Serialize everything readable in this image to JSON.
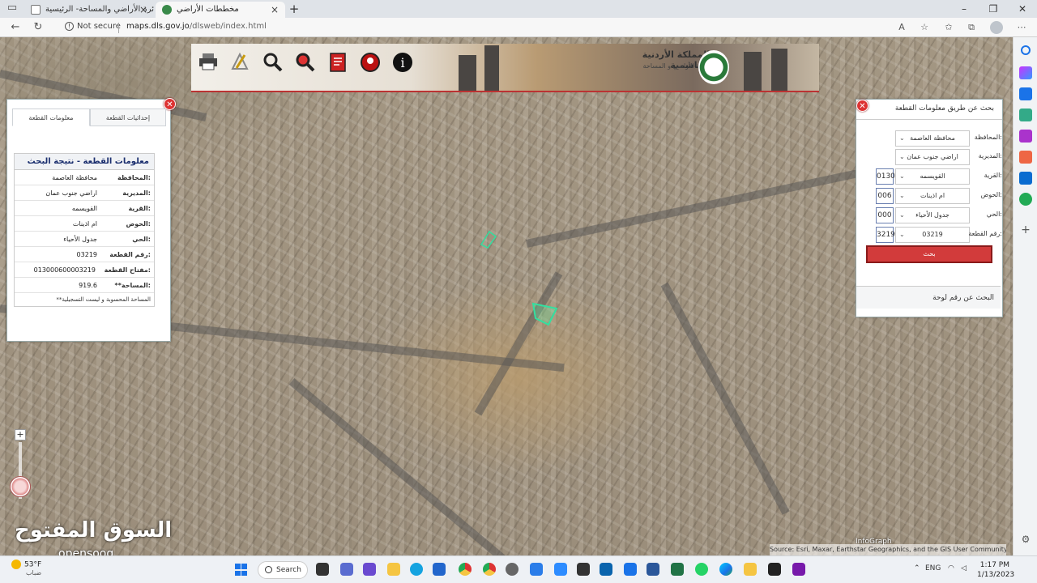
{
  "browser": {
    "tabs": [
      {
        "label": "دائرة الأراضي والمساحة- الرئيسية-",
        "active": false
      },
      {
        "label": "مخططات الأراضي",
        "active": true
      }
    ],
    "security_label": "Not secure",
    "url_host": "maps.dls.gov.jo",
    "url_path": "/dlsweb/index.html"
  },
  "banner": {
    "title": "المملكة الأردنية الهاشمية",
    "subtitle": "دائرة الأراضي و المساحة",
    "tools": [
      "print-icon",
      "measure-icon",
      "zoom-search-icon",
      "parcel-search-icon",
      "report-icon",
      "location-pin-icon",
      "info-icon"
    ]
  },
  "left_panel": {
    "tabs": [
      {
        "label": "إحداثيات القطعة"
      },
      {
        "label": "معلومات القطعة"
      }
    ],
    "result_title": "معلومات القطعة - نتيجة البحث",
    "rows": [
      {
        "label": "المحافظة:",
        "value": "محافظة العاصمة"
      },
      {
        "label": "المديرية:",
        "value": "اراضي جنوب عمان"
      },
      {
        "label": "القرية:",
        "value": "القويسمه"
      },
      {
        "label": "الحوض:",
        "value": "ام اذينات"
      },
      {
        "label": "الحي:",
        "value": "جدول الأحياء"
      },
      {
        "label": "رقم القطعة:",
        "value": "03219"
      },
      {
        "label": "مفتاح القطعة:",
        "value": "013000600003219"
      },
      {
        "label": "**المساحة:",
        "value": "919.6"
      }
    ],
    "note": "**المساحة المحسوبة و ليست التسجيلية"
  },
  "right_panel": {
    "title": "بحث عن طريق معلومات القطعة",
    "fields": [
      {
        "label": "المحافظة:",
        "selected": "محافظة العاصمة",
        "code": ""
      },
      {
        "label": "المديرية:",
        "selected": "اراضي جنوب عمان",
        "code": ""
      },
      {
        "label": "القرية:",
        "selected": "القويسمه",
        "code": "0130"
      },
      {
        "label": "الحوض:",
        "selected": "ام اذينات",
        "code": "006"
      },
      {
        "label": "الحي:",
        "selected": "جدول الأحياء",
        "code": "000"
      },
      {
        "label": "رقم القطعة:",
        "selected": "03219",
        "code": "3219"
      }
    ],
    "search_label": "بحث",
    "alt_search_label": "البحث عن رقم لوحة"
  },
  "map": {
    "zoom_in": "+",
    "watermark": "السوق المفتوح",
    "watermark_latin": "opensooq",
    "attribution": "Source: Esri, Maxar, Earthstar Geographics, and the GIS User Community",
    "infograph": "InfoGraph"
  },
  "taskbar": {
    "weather_temp": "53°F",
    "weather_desc": "ضباب",
    "search_label": "Search",
    "lang": "ENG",
    "time": "1:17 PM",
    "date": "1/13/2023"
  },
  "colors": {
    "accent_red": "#d23b3b",
    "title_blue": "#1a2e6e",
    "parcel_outline": "#33e0a0"
  }
}
